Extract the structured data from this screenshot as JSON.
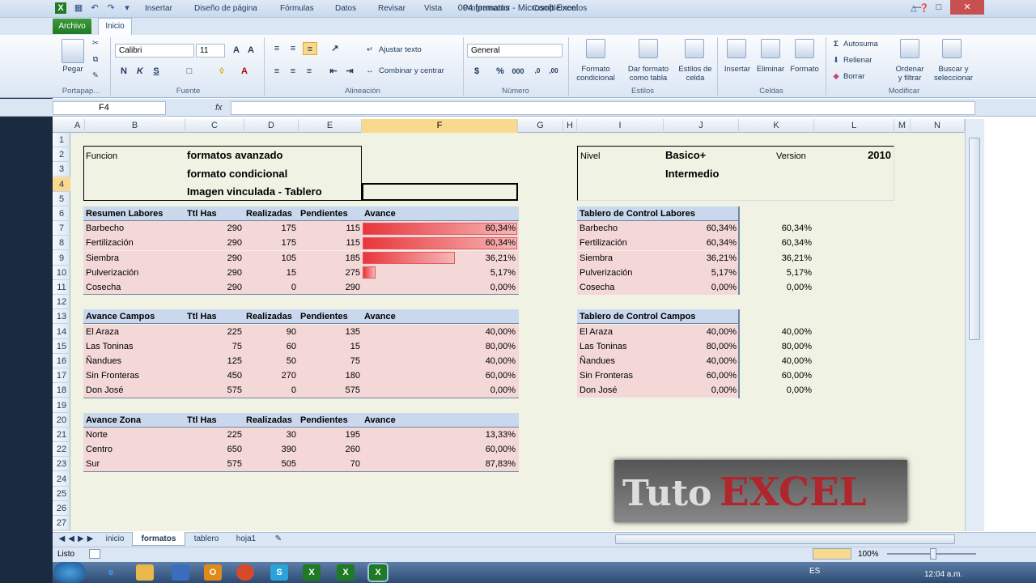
{
  "window": {
    "title": "004 formatos - Microsoft Excel"
  },
  "ribbon": {
    "tabs": [
      "Archivo",
      "Inicio",
      "Insertar",
      "Diseño de página",
      "Fórmulas",
      "Datos",
      "Revisar",
      "Vista",
      "Programador",
      "Complementos"
    ],
    "groups": {
      "clipboard": "Portapap...",
      "font": "Fuente",
      "alignment": "Alineación",
      "number": "Número",
      "styles": "Estilos",
      "cells": "Celdas",
      "modify": "Modificar"
    },
    "paste": "Pegar",
    "font_name": "Calibri",
    "font_size": "11",
    "wrap_text": "Ajustar texto",
    "merge_center": "Combinar y centrar",
    "number_format": "General",
    "cond_format": [
      "Formato",
      "condicional"
    ],
    "format_table": [
      "Dar formato",
      "como tabla"
    ],
    "cell_styles": [
      "Estilos de",
      "celda"
    ],
    "insert": "Insertar",
    "delete": "Eliminar",
    "format": "Formato",
    "autosum": "Autosuma",
    "fill": "Rellenar",
    "clear": "Borrar",
    "sort_filter": [
      "Ordenar",
      "y filtrar"
    ],
    "find_select": [
      "Buscar y",
      "seleccionar"
    ]
  },
  "formula_bar": {
    "name_box": "F4",
    "fx": "fx",
    "value": ""
  },
  "columns": [
    "A",
    "B",
    "C",
    "D",
    "E",
    "F",
    "G",
    "H",
    "I",
    "J",
    "K",
    "L",
    "M",
    "N"
  ],
  "rows": [
    "1",
    "2",
    "3",
    "4",
    "5",
    "6",
    "7",
    "8",
    "9",
    "10",
    "11",
    "12",
    "13",
    "14",
    "15",
    "16",
    "17",
    "18",
    "19",
    "20",
    "21",
    "22",
    "23",
    "24",
    "25",
    "26",
    "27"
  ],
  "header_block": {
    "label": "Funcion",
    "lines": [
      "formatos avanzado",
      "formato condicional",
      "Imagen vinculada - Tablero"
    ]
  },
  "level_block": {
    "label": "Nivel",
    "levels": [
      "Basico+",
      "Intermedio"
    ],
    "version_label": "Version",
    "version": "2010"
  },
  "table_headers": {
    "has": "Ttl Has",
    "done": "Realizadas",
    "pending": "Pendientes",
    "progress": "Avance"
  },
  "labores": {
    "title": "Resumen Labores",
    "rows": [
      {
        "name": "Barbecho",
        "has": "290",
        "done": "175",
        "pending": "115",
        "pct": "60,34%",
        "frac": 0.6034
      },
      {
        "name": "Fertilización",
        "has": "290",
        "done": "175",
        "pending": "115",
        "pct": "60,34%",
        "frac": 0.6034
      },
      {
        "name": "Siembra",
        "has": "290",
        "done": "105",
        "pending": "185",
        "pct": "36,21%",
        "frac": 0.3621
      },
      {
        "name": "Pulverización",
        "has": "290",
        "done": "15",
        "pending": "275",
        "pct": "5,17%",
        "frac": 0.0517
      },
      {
        "name": "Cosecha",
        "has": "290",
        "done": "0",
        "pending": "290",
        "pct": "0,00%",
        "frac": 0
      }
    ]
  },
  "campos": {
    "title": "Avance Campos",
    "rows": [
      {
        "name": "El Araza",
        "has": "225",
        "done": "90",
        "pending": "135",
        "pct": "40,00%"
      },
      {
        "name": "Las Toninas",
        "has": "75",
        "done": "60",
        "pending": "15",
        "pct": "80,00%"
      },
      {
        "name": "Ñandues",
        "has": "125",
        "done": "50",
        "pending": "75",
        "pct": "40,00%"
      },
      {
        "name": "Sin Fronteras",
        "has": "450",
        "done": "270",
        "pending": "180",
        "pct": "60,00%"
      },
      {
        "name": "Don José",
        "has": "575",
        "done": "0",
        "pending": "575",
        "pct": "0,00%"
      }
    ]
  },
  "zona": {
    "title": "Avance Zona",
    "rows": [
      {
        "name": "Norte",
        "has": "225",
        "done": "30",
        "pending": "195",
        "pct": "13,33%"
      },
      {
        "name": "Centro",
        "has": "650",
        "done": "390",
        "pending": "260",
        "pct": "60,00%"
      },
      {
        "name": "Sur",
        "has": "575",
        "done": "505",
        "pending": "70",
        "pct": "87,83%"
      }
    ]
  },
  "dash_labores": {
    "title": "Tablero de Control Labores",
    "rows": [
      {
        "name": "Barbecho",
        "pct": "60,34%",
        "pct2": "60,34%"
      },
      {
        "name": "Fertilización",
        "pct": "60,34%",
        "pct2": "60,34%"
      },
      {
        "name": "Siembra",
        "pct": "36,21%",
        "pct2": "36,21%"
      },
      {
        "name": "Pulverización",
        "pct": "5,17%",
        "pct2": "5,17%"
      },
      {
        "name": "Cosecha",
        "pct": "0,00%",
        "pct2": "0,00%"
      }
    ]
  },
  "dash_campos": {
    "title": "Tablero de Control Campos",
    "rows": [
      {
        "name": "El Araza",
        "pct": "40,00%",
        "pct2": "40,00%"
      },
      {
        "name": "Las Toninas",
        "pct": "80,00%",
        "pct2": "80,00%"
      },
      {
        "name": "Ñandues",
        "pct": "40,00%",
        "pct2": "40,00%"
      },
      {
        "name": "Sin Fronteras",
        "pct": "60,00%",
        "pct2": "60,00%"
      },
      {
        "name": "Don José",
        "pct": "0,00%",
        "pct2": "0,00%"
      }
    ]
  },
  "sheet_tabs": [
    "inicio",
    "formatos",
    "tablero",
    "hoja1"
  ],
  "active_sheet": "formatos",
  "status": {
    "ready": "Listo",
    "zoom": "100%"
  },
  "watermark": {
    "part1": "Tuto",
    "part2": "EXCEL"
  },
  "taskbar": {
    "lang": "ES",
    "clock": "12:04 a.m."
  }
}
